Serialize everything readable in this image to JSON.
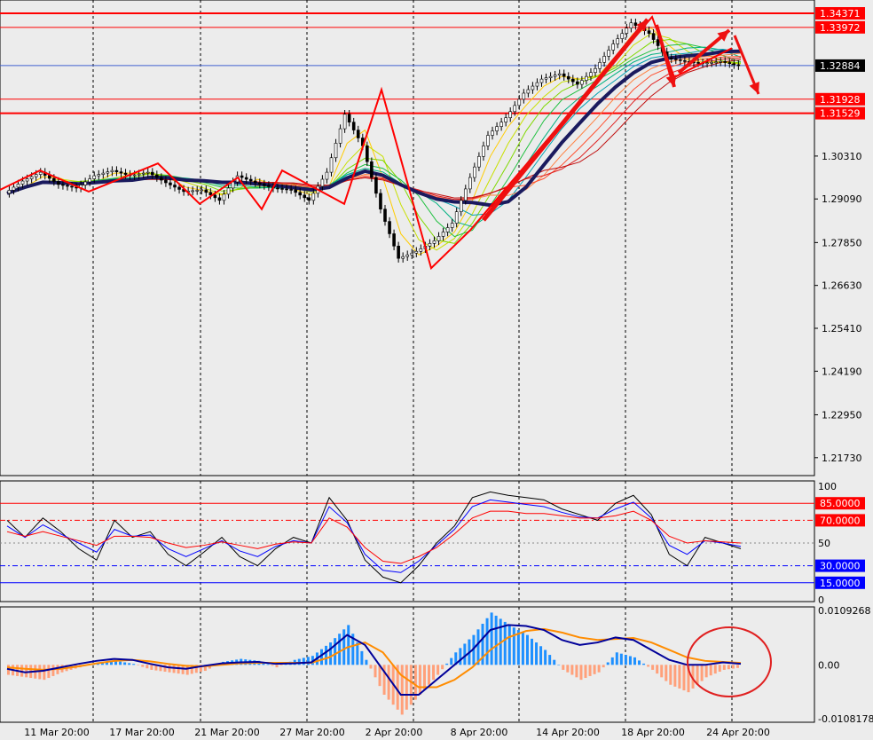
{
  "chart_data": {
    "type": "candlestick",
    "x_labels": [
      "11 Mar 20:00",
      "17 Mar 20:00",
      "21 Mar 20:00",
      "27 Mar 20:00",
      "2 Apr 20:00",
      "8 Apr 20:00",
      "14 Apr 20:00",
      "18 Apr 20:00",
      "24 Apr 20:00"
    ],
    "price_axis": {
      "ticks": [
        "1.30310",
        "1.29090",
        "1.27850",
        "1.26630",
        "1.25410",
        "1.24190",
        "1.22950",
        "1.21730"
      ],
      "range": [
        1.2122,
        1.3475
      ]
    },
    "price_levels": [
      {
        "label": "1.34371",
        "value": 1.34371,
        "color": "#ff0000"
      },
      {
        "label": "1.33972",
        "value": 1.33972,
        "color": "#ff0000"
      },
      {
        "label": "1.31928",
        "value": 1.31928,
        "color": "#ff0000"
      },
      {
        "label": "1.31529",
        "value": 1.31529,
        "color": "#ff0000"
      },
      {
        "label": "1.32884",
        "value": 1.32884,
        "color": "#000000"
      }
    ],
    "zigzag_points": [
      [
        1.2935,
        0
      ],
      [
        1.299,
        1
      ],
      [
        1.293,
        2
      ],
      [
        1.301,
        3
      ],
      [
        1.2895,
        4
      ],
      [
        1.297,
        5
      ],
      [
        1.288,
        6
      ],
      [
        1.299,
        7
      ],
      [
        1.2895,
        8
      ],
      [
        1.322,
        9
      ],
      [
        1.2712,
        10
      ],
      [
        1.282,
        11
      ],
      [
        1.3427,
        12
      ],
      [
        1.3255,
        13
      ],
      [
        1.3338,
        14
      ]
    ],
    "price_path": [
      [
        0,
        1.2925
      ],
      [
        1,
        1.296
      ],
      [
        2,
        1.2985
      ],
      [
        3,
        1.295
      ],
      [
        4,
        1.294
      ],
      [
        5,
        1.2975
      ],
      [
        6,
        1.299
      ],
      [
        7,
        1.2975
      ],
      [
        8,
        1.2985
      ],
      [
        9,
        1.2955
      ],
      [
        10,
        1.293
      ],
      [
        11,
        1.2935
      ],
      [
        12,
        1.2905
      ],
      [
        13,
        1.2975
      ],
      [
        14,
        1.2955
      ],
      [
        15,
        1.294
      ],
      [
        16,
        1.2935
      ],
      [
        17,
        1.2905
      ],
      [
        18,
        1.2985
      ],
      [
        19,
        1.315
      ],
      [
        20,
        1.306
      ],
      [
        21,
        1.288
      ],
      [
        22,
        1.274
      ],
      [
        23,
        1.276
      ],
      [
        24,
        1.279
      ],
      [
        25,
        1.284
      ],
      [
        26,
        1.297
      ],
      [
        27,
        1.309
      ],
      [
        28,
        1.314
      ],
      [
        29,
        1.321
      ],
      [
        30,
        1.325
      ],
      [
        31,
        1.3265
      ],
      [
        32,
        1.3235
      ],
      [
        33,
        1.328
      ],
      [
        34,
        1.335
      ],
      [
        35,
        1.341
      ],
      [
        36,
        1.338
      ],
      [
        37,
        1.331
      ],
      [
        38,
        1.33
      ],
      [
        39,
        1.3295
      ],
      [
        40,
        1.33
      ],
      [
        41,
        1.3288
      ]
    ],
    "oscillator": {
      "axis_ticks": [
        "100",
        "50",
        "0"
      ],
      "levels": [
        {
          "label": "85.0000",
          "value": 85,
          "color": "#ff0000"
        },
        {
          "label": "70.0000",
          "value": 70,
          "color": "#ff0000"
        },
        {
          "label": "30.0000",
          "value": 30,
          "color": "#0000ff"
        },
        {
          "label": "15.0000",
          "value": 15,
          "color": "#0000ff"
        }
      ],
      "series": [
        {
          "color": "#000000",
          "values": [
            70,
            55,
            72,
            60,
            45,
            35,
            70,
            55,
            60,
            40,
            30,
            42,
            55,
            38,
            30,
            45,
            55,
            50,
            90,
            70,
            35,
            20,
            15,
            30,
            50,
            65,
            90,
            95,
            92,
            90,
            88,
            80,
            75,
            70,
            85,
            92,
            75,
            40,
            30,
            55,
            50,
            45
          ]
        },
        {
          "color": "#0000ff",
          "values": [
            65,
            55,
            66,
            58,
            50,
            42,
            62,
            56,
            57,
            45,
            38,
            45,
            52,
            43,
            38,
            47,
            52,
            50,
            82,
            68,
            40,
            26,
            24,
            34,
            48,
            62,
            82,
            88,
            86,
            84,
            82,
            77,
            73,
            72,
            80,
            86,
            72,
            48,
            40,
            52,
            50,
            47
          ]
        },
        {
          "color": "#ff0000",
          "values": [
            60,
            56,
            60,
            56,
            52,
            48,
            56,
            56,
            55,
            50,
            46,
            48,
            51,
            48,
            45,
            49,
            51,
            50,
            72,
            64,
            46,
            34,
            32,
            38,
            46,
            58,
            72,
            78,
            78,
            76,
            76,
            74,
            72,
            72,
            74,
            78,
            70,
            56,
            50,
            52,
            51,
            50
          ]
        }
      ]
    },
    "macd": {
      "axis_ticks": [
        "0.0109268",
        "0.00",
        "-0.0108178"
      ],
      "range": [
        -0.0108178,
        0.0109268
      ],
      "histogram": [
        -0.002,
        -0.0025,
        -0.003,
        -0.0015,
        -0.0005,
        0.0005,
        0.0008,
        0.0002,
        -0.001,
        -0.0015,
        -0.002,
        -0.0012,
        0.0006,
        0.0012,
        0.0008,
        -0.0005,
        0.001,
        0.0018,
        0.0045,
        0.008,
        0.001,
        -0.006,
        -0.01,
        -0.006,
        -0.002,
        0.0025,
        0.006,
        0.0105,
        0.008,
        0.006,
        0.003,
        -0.001,
        -0.003,
        -0.0015,
        0.0025,
        0.0015,
        -0.001,
        -0.004,
        -0.0055,
        -0.0025,
        -0.001,
        -0.0005
      ],
      "macd_line": [
        -0.0008,
        -0.0015,
        -0.0012,
        -0.0005,
        0.0002,
        0.0008,
        0.0012,
        0.001,
        0.0002,
        -0.0005,
        -0.0008,
        -0.0002,
        0.0003,
        0.0005,
        0.0006,
        0.0002,
        0.0003,
        0.0005,
        0.003,
        0.006,
        0.004,
        -0.001,
        -0.006,
        -0.006,
        -0.003,
        0.0,
        0.003,
        0.007,
        0.008,
        0.0078,
        0.007,
        0.005,
        0.004,
        0.0045,
        0.0055,
        0.005,
        0.003,
        0.001,
        0.0,
        0.0,
        0.0005,
        0.0002
      ],
      "signal_line": [
        -0.0005,
        -0.0008,
        -0.001,
        -0.0008,
        -0.0003,
        0.0003,
        0.0008,
        0.001,
        0.0007,
        0.0002,
        -0.0002,
        -0.0003,
        0.0,
        0.0003,
        0.0004,
        0.0004,
        0.0004,
        0.0004,
        0.0015,
        0.0035,
        0.0045,
        0.0025,
        -0.002,
        -0.0045,
        -0.0045,
        -0.003,
        -0.0005,
        0.003,
        0.0055,
        0.0068,
        0.0072,
        0.0065,
        0.0055,
        0.005,
        0.0052,
        0.0054,
        0.0045,
        0.003,
        0.0015,
        0.0008,
        0.0006,
        0.0004
      ],
      "pos_color": "#1e90ff",
      "neg_color": "#ffa07a",
      "macd_color": "#000099",
      "signal_color": "#ff8c00"
    }
  }
}
